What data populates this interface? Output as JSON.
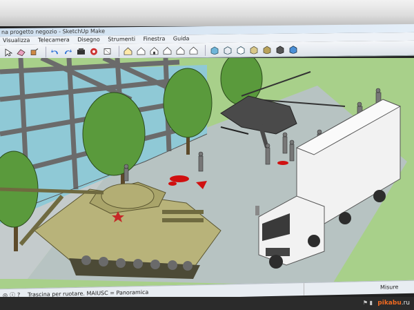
{
  "window": {
    "title": "na progetto negozio - SketchUp Make"
  },
  "menu": {
    "items": [
      "Visualizza",
      "Telecamera",
      "Disegno",
      "Strumenti",
      "Finestra",
      "Guida"
    ]
  },
  "toolbar": {
    "icons": [
      "select-icon",
      "eraser-icon",
      "paint-icon",
      "undo-icon",
      "redo-icon",
      "orbit-icon",
      "pan-icon",
      "rect-icon",
      "house-iso-icon",
      "house-top-icon",
      "house-front-icon",
      "house-right-icon",
      "house-back-icon",
      "house-left-icon",
      "xray-icon",
      "wireframe-icon",
      "hidden-line-icon",
      "shaded-icon",
      "textured-icon",
      "monochrome-icon",
      "style-icon"
    ]
  },
  "status": {
    "hint": "Trascina per ruotare. MAIUSC = Panoramica",
    "measure_label": "Misure"
  },
  "watermark": {
    "prefix": "",
    "brand": "pikabu",
    "suffix": ".ru"
  },
  "colors": {
    "ground": "#a8d08a",
    "road": "#b7c3c2",
    "glass": "#8fc9d6",
    "tree": "#5a9a3c",
    "tank": "#b8b37a",
    "truck": "#f2f2f2",
    "helicopter": "#4a4a4a",
    "blood": "#d01010"
  }
}
